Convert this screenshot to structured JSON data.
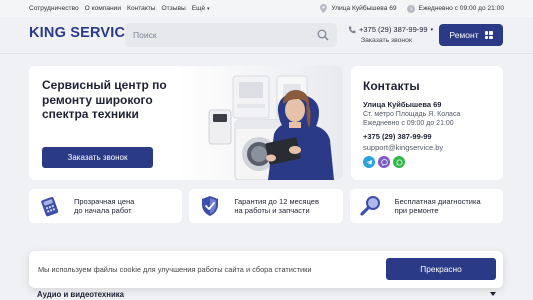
{
  "topbar": {
    "nav": [
      {
        "label": "Сотрудничество"
      },
      {
        "label": "О компании"
      },
      {
        "label": "Контакты"
      },
      {
        "label": "Отзывы"
      },
      {
        "label": "Ещё"
      }
    ],
    "address": "Улица Куйбышева 69",
    "hours": "Ежедневно с 09:00 до 21:00"
  },
  "header": {
    "logo": "KING SERVICE",
    "search_placeholder": "Поиск",
    "phone": "+375 (29) 387-99-99",
    "callback": "Заказать звонок",
    "repair_button": "Ремонт"
  },
  "hero": {
    "title": "Сервисный центр по ремонту широкого спектра техники",
    "button": "Заказать звонок"
  },
  "contacts": {
    "title": "Контакты",
    "address": "Улица Куйбышева 69",
    "metro": "Ст. метро Площадь Я. Коласа",
    "hours": "Ежедневно с 09:00 до 21:00",
    "phone": "+375 (29) 387-99-99",
    "email": "support@kingservice.by",
    "socials": [
      {
        "icon": "telegram-icon",
        "color": "#2aa3dd"
      },
      {
        "icon": "viber-icon",
        "color": "#7d5bc7"
      },
      {
        "icon": "whatsapp-icon",
        "color": "#30b84a"
      }
    ]
  },
  "features": [
    {
      "line1": "Прозрачная цена",
      "line2": "до начала работ",
      "icon": "calculator-icon"
    },
    {
      "line1": "Гарантия до 12 месяцев",
      "line2": "на работы и запчасти",
      "icon": "shield-check-icon"
    },
    {
      "line1": "Бесплатная диагностика",
      "line2": "при ремонте",
      "icon": "magnifier-icon"
    }
  ],
  "cookie": {
    "text": "Мы используем файлы cookie для улучшения работы сайта и сбора статистики",
    "button": "Прекрасно"
  },
  "category": {
    "label": "Аудио и видеотехника"
  },
  "colors": {
    "brand": "#2b3a87",
    "background": "#f0f1f4"
  }
}
